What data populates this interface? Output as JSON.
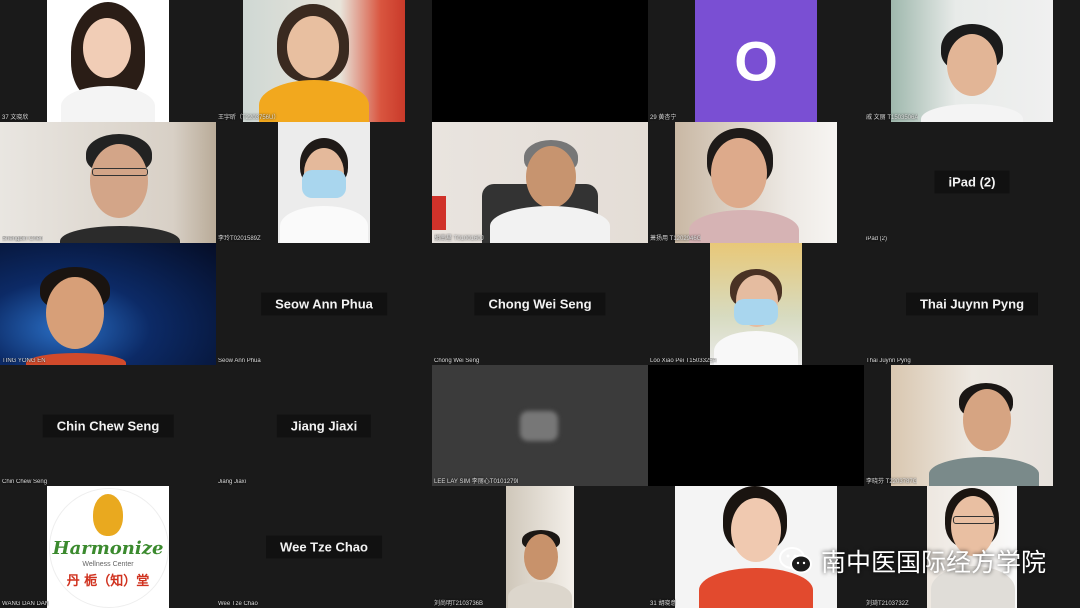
{
  "participants": [
    {
      "label": "37 文晓欣"
    },
    {
      "label": "王宇昕（T2203756U）"
    },
    {
      "label": ""
    },
    {
      "label": "29 黄杏宁",
      "avatar_letter": "O",
      "avatar_color": "#7a4fd3"
    },
    {
      "label": "戚 文丽 T1503506A"
    },
    {
      "label": "Shengbin Chen"
    },
    {
      "label": "李玲T0201589Z"
    },
    {
      "label": "胡南星 T0100160J"
    },
    {
      "label": "萧扬用 T1202946G"
    },
    {
      "label": "iPad (2)",
      "display_name": "iPad (2)"
    },
    {
      "label": "TING YONG EN"
    },
    {
      "label": "Seow Ann Phua",
      "display_name": "Seow Ann Phua"
    },
    {
      "label": "Chong Wei Seng",
      "display_name": "Chong Wei Seng"
    },
    {
      "label": "Loo Xiao Pei T1503325A"
    },
    {
      "label": "Thai Juynn Pyng",
      "display_name": "Thai Juynn Pyng"
    },
    {
      "label": "Chin Chew Seng",
      "display_name": "Chin Chew Seng"
    },
    {
      "label": "Jiang Jiaxi",
      "display_name": "Jiang Jiaxi"
    },
    {
      "label": "LEE LAY SIM 李丽心T0101279I"
    },
    {
      "label": ""
    },
    {
      "label": "李晓芬 T2203787G"
    },
    {
      "label": "WANG DAN DAN",
      "logo_text": "Harmonize",
      "logo_subtext": "Wellness Center",
      "logo_chinese": "丹 栀（知）堂"
    },
    {
      "label": "Wee Tze Chao",
      "display_name": "Wee Tze Chao"
    },
    {
      "label": "刘尚明T2103736B"
    },
    {
      "label": "31 胡晓意"
    },
    {
      "label": "刘琦T2103732Z"
    }
  ],
  "watermark": {
    "text": "南中医国际经方学院",
    "icon": "wechat-icon"
  }
}
